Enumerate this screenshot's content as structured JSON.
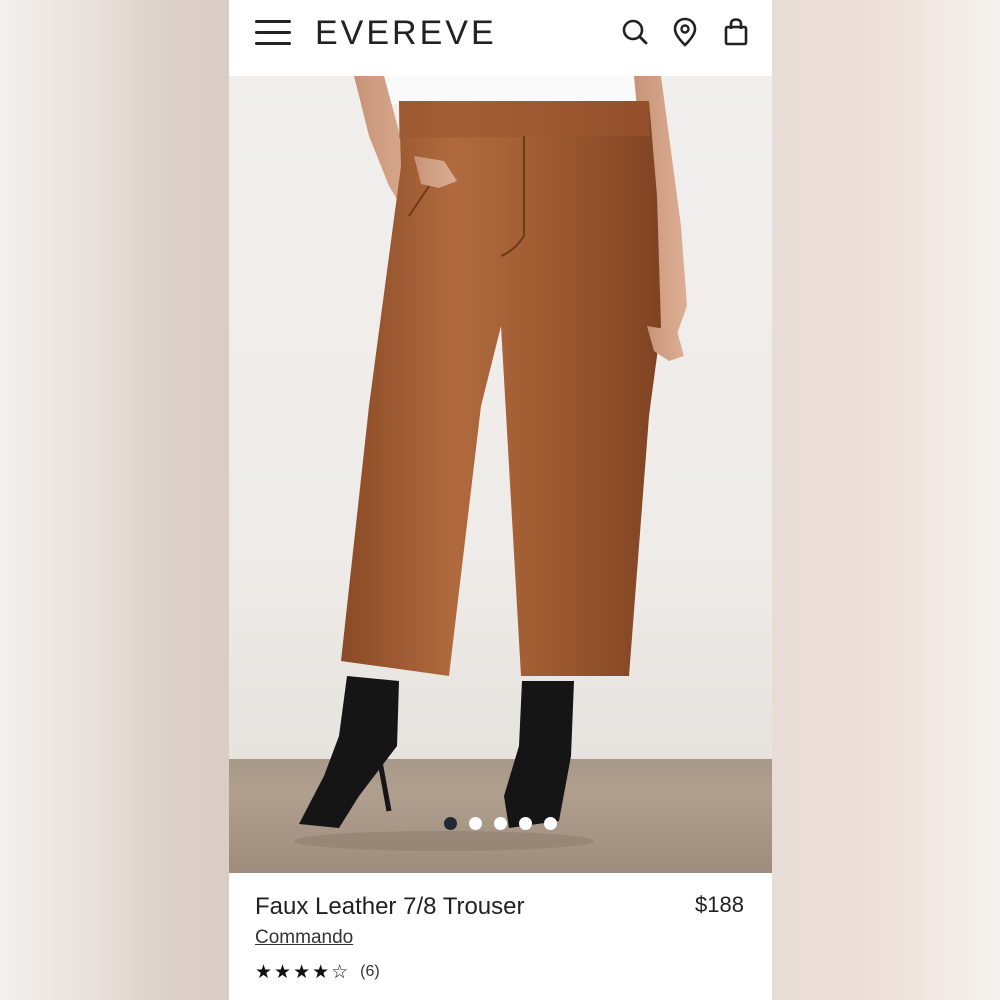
{
  "header": {
    "logo": "EVEREVE",
    "icons": [
      "menu-icon",
      "search-icon",
      "location-icon",
      "bag-icon"
    ]
  },
  "carousel": {
    "total_slides": 5,
    "active_index": 0
  },
  "product": {
    "title": "Faux Leather 7/8 Trouser",
    "price": "$188",
    "brand": "Commando",
    "rating_stars": "★★★★☆",
    "rating_value": 4,
    "review_count": "(6)"
  },
  "colors": {
    "text": "#222222",
    "active_dot": "#1f2a35",
    "pants": "#a05a30"
  }
}
